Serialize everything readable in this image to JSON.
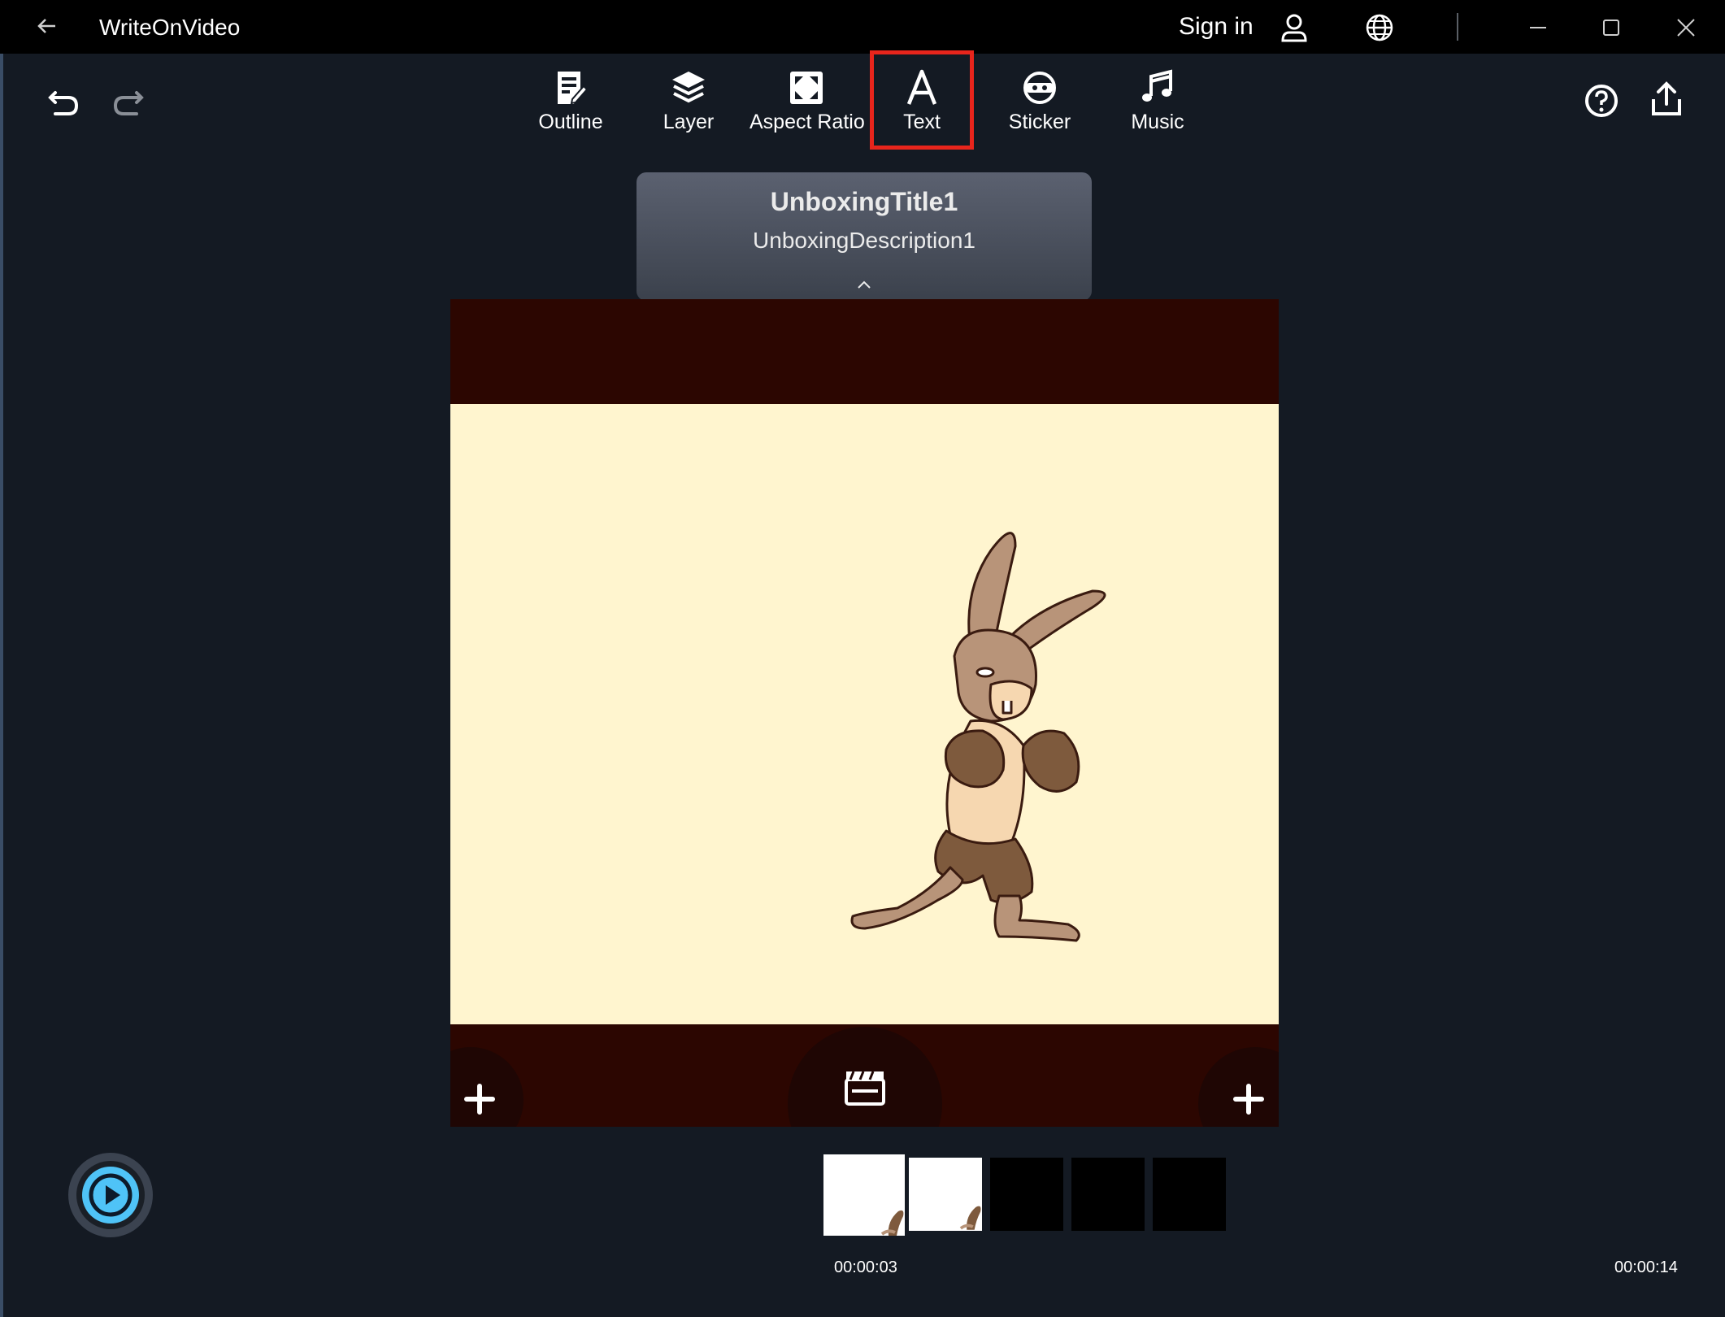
{
  "app": {
    "title": "WriteOnVideo"
  },
  "titlebar": {
    "back_icon": "back-arrow-icon",
    "signin_label": "Sign in",
    "account_icon": "account-icon",
    "language_icon": "globe-icon",
    "minimize_icon": "minimize-icon",
    "maximize_icon": "maximize-icon",
    "close_icon": "close-icon"
  },
  "toolbar": {
    "undo_icon": "undo-icon",
    "redo_icon": "redo-icon",
    "tools": [
      {
        "label": "Outline",
        "icon": "outline-icon"
      },
      {
        "label": "Layer",
        "icon": "layer-icon"
      },
      {
        "label": "Aspect Ratio",
        "icon": "aspect-ratio-icon"
      },
      {
        "label": "Text",
        "icon": "text-icon",
        "selected": true
      },
      {
        "label": "Sticker",
        "icon": "sticker-icon"
      },
      {
        "label": "Music",
        "icon": "music-icon"
      }
    ],
    "help_icon": "help-icon",
    "share_icon": "share-icon"
  },
  "title_card": {
    "title": "UnboxingTitle1",
    "description": "UnboxingDescription1",
    "collapse_icon": "chevron-up-icon"
  },
  "canvas": {
    "add_left_icon": "plus-icon",
    "clapper_icon": "clapperboard-icon",
    "add_right_icon": "plus-icon",
    "image": "boxing-rabbit-illustration"
  },
  "timeline": {
    "play_icon": "play-icon",
    "current_time": "00:00:03",
    "total_time": "00:00:14"
  },
  "colors": {
    "highlight": "#e8251c",
    "canvas_bar": "#2c0601",
    "stage": "#fff5cf",
    "play_button": "#4fc3f7"
  }
}
